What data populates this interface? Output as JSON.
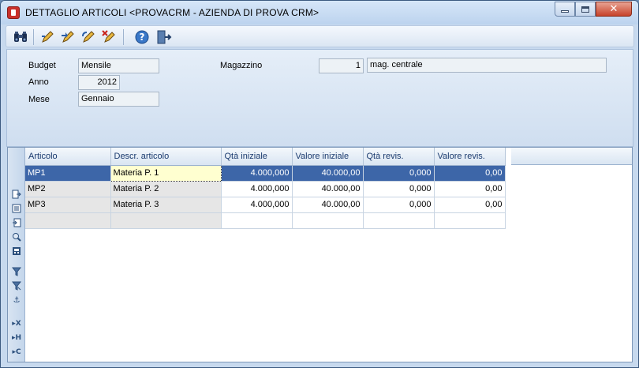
{
  "window": {
    "title": "DETTAGLIO ARTICOLI <PROVACRM - AZIENDA DI PROVA CRM>",
    "close_glyph": "✕"
  },
  "toolbar": {
    "icons": [
      "binoculars-icon",
      "edit-icon",
      "edit-next-icon",
      "edit-undo-icon",
      "delete-icon",
      "help-icon",
      "exit-icon"
    ]
  },
  "form": {
    "budget_label": "Budget",
    "budget_value": "Mensile",
    "anno_label": "Anno",
    "anno_value": "2012",
    "mese_label": "Mese",
    "mese_value": "Gennaio",
    "magazzino_label": "Magazzino",
    "magazzino_code": "1",
    "magazzino_desc": "mag. centrale"
  },
  "grid": {
    "columns": [
      "Articolo",
      "Descr. articolo",
      "Qtà iniziale",
      "Valore iniziale",
      "Qtà revis.",
      "Valore revis."
    ],
    "rows": [
      {
        "articolo": "MP1",
        "descr": "Materia P. 1",
        "qta_iniziale": "4.000,000",
        "valore_iniziale": "40.000,00",
        "qta_revis": "0,000",
        "valore_revis": "0,00"
      },
      {
        "articolo": "MP2",
        "descr": "Materia P. 2",
        "qta_iniziale": "4.000,000",
        "valore_iniziale": "40.000,00",
        "qta_revis": "0,000",
        "valore_revis": "0,00"
      },
      {
        "articolo": "MP3",
        "descr": "Materia P. 3",
        "qta_iniziale": "4.000,000",
        "valore_iniziale": "40.000,00",
        "qta_revis": "0,000",
        "valore_revis": "0,00"
      }
    ]
  },
  "side_icons": {
    "filter_x": "▸X",
    "filter_h": "▸H",
    "filter_c": "▸C",
    "anchor": "⚓"
  },
  "colors": {
    "selection": "#3d66a8",
    "focus_cell": "#ffffd0",
    "header_text": "#1a3a6e"
  }
}
